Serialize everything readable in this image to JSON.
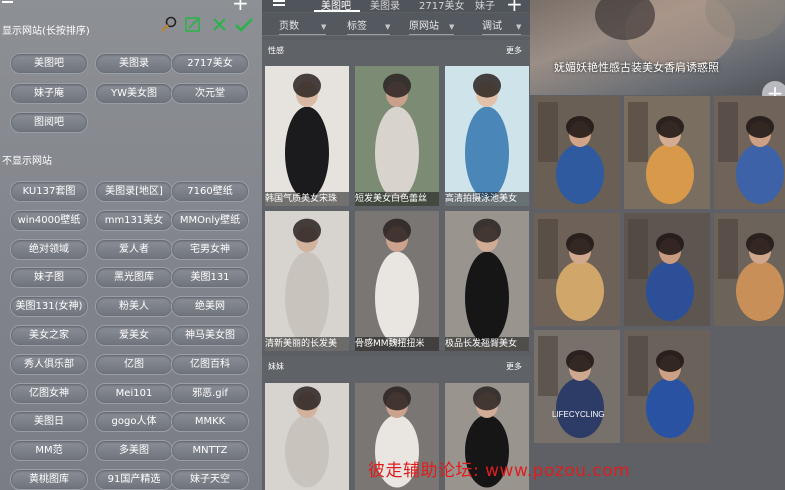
{
  "left_panel": {
    "menu_icon": "hamburger-icon",
    "add_icon": "plus-icon",
    "shown_title": "显示网站(长按排序)",
    "hidden_title": "不显示网站",
    "toolbar": {
      "search_icon": "magnifier-icon",
      "edit_icon": "edit-icon",
      "delete_icon": "close-icon",
      "confirm_icon": "check-icon"
    },
    "shown_sites": [
      "美图吧",
      "美图录",
      "2717美女",
      "妹子庵",
      "YW美女图",
      "次元堂",
      "图阅吧"
    ],
    "hidden_sites": [
      "KU137套图",
      "美图录[地区]",
      "7160壁纸",
      "win4000壁纸",
      "mm131美女",
      "MMOnly壁纸",
      "绝对领域",
      "爱人者",
      "宅男女神",
      "妹子图",
      "黑光图库",
      "美图131",
      "美图131(女神)",
      "粉美人",
      "绝美网",
      "美女之家",
      "爱美女",
      "神马美女图",
      "秀人俱乐部",
      "亿图",
      "亿图百科",
      "亿图女神",
      "Mei101",
      "邪恶.gif",
      "美图日",
      "gogo人体",
      "MMKK",
      "MM范",
      "多美图",
      "MNTTZ",
      "黄桃图库",
      "91国产精选",
      "妹子天空"
    ]
  },
  "middle_panel": {
    "menu_icon": "hamburger-icon",
    "tabs": [
      "美图吧",
      "美图录",
      "2717美女",
      "妹子"
    ],
    "active_tab": "美图吧",
    "filters": [
      "页数",
      "标签",
      "原网站",
      "调试"
    ],
    "sections": [
      {
        "title": "性感",
        "more": "更多",
        "items": [
          "韩国气质美女宋珠",
          "短发美女白色蕾丝",
          "高清拍摄泳池美女",
          "清新美丽的长发美",
          "骨感MM魏扭扭米",
          "极品长发翘臀美女"
        ]
      },
      {
        "title": "妹妹",
        "more": "更多",
        "items": [
          "",
          "",
          ""
        ]
      }
    ]
  },
  "right_panel": {
    "title": "妩媚妖艳性感古装美女香肩诱惑照",
    "fab_icon": "plus-icon",
    "photo_text": "LIFECYCLING"
  },
  "watermark": "彼走辅助论坛: www.pozou.com",
  "colors": {
    "accent_green": "#2bb34a",
    "watermark_red": "#e01d1d",
    "button_bg": "#7d8189"
  }
}
